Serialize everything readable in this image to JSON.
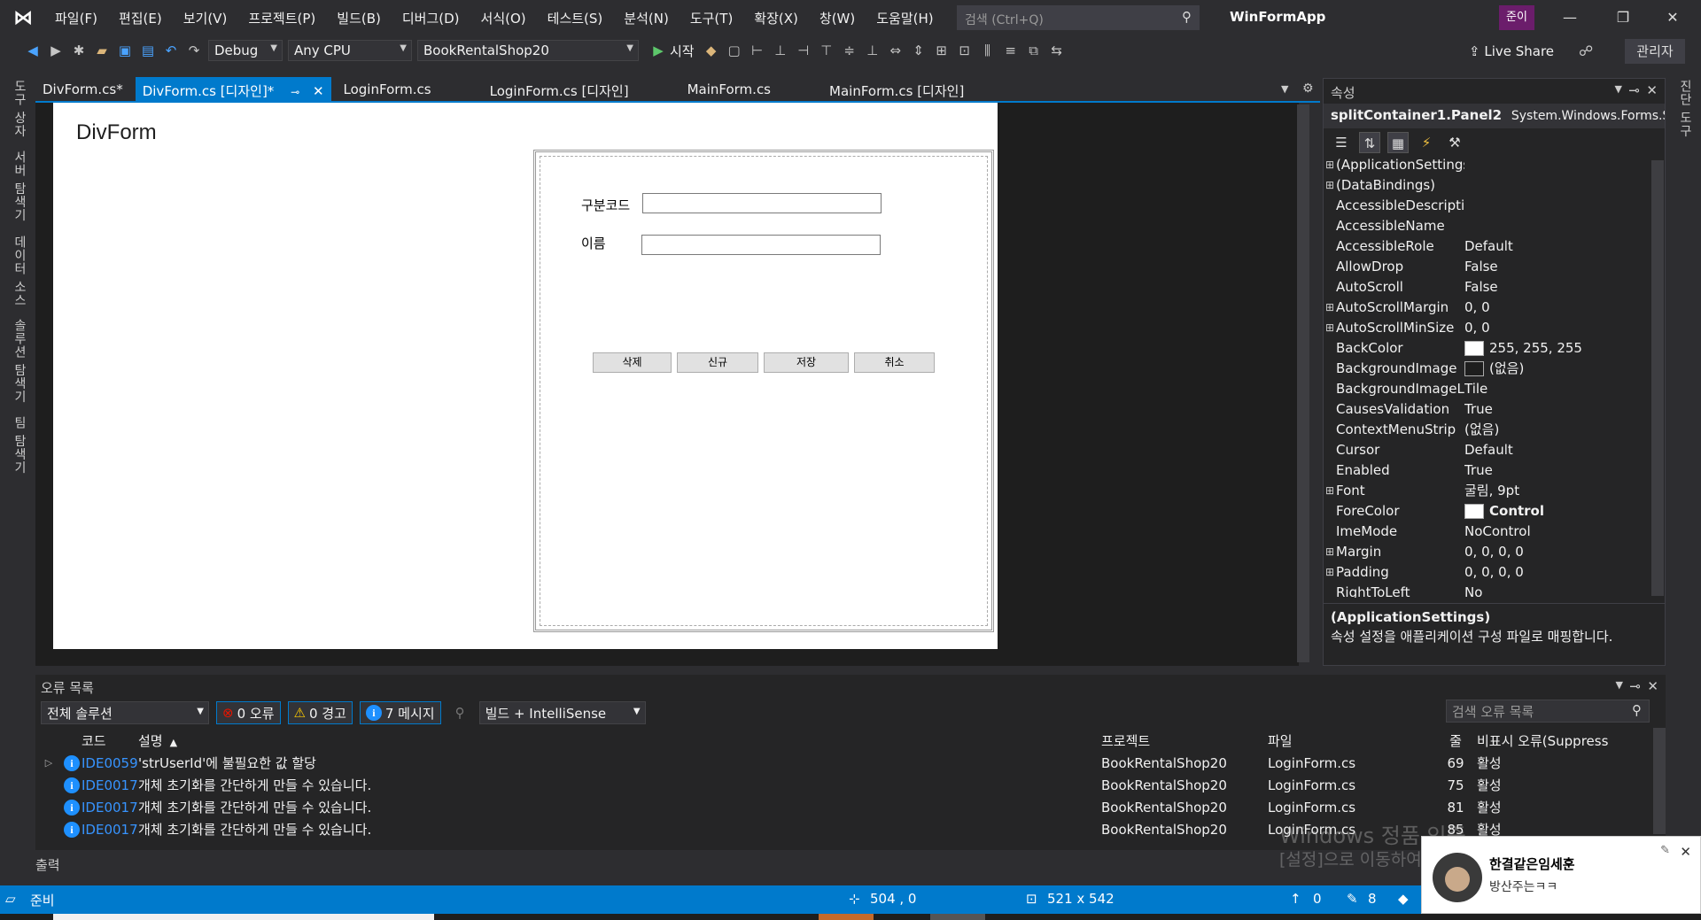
{
  "menubar": {
    "items": [
      "파일(F)",
      "편집(E)",
      "보기(V)",
      "프로젝트(P)",
      "빌드(B)",
      "디버그(D)",
      "서식(O)",
      "테스트(S)",
      "분석(N)",
      "도구(T)",
      "확장(X)",
      "창(W)",
      "도움말(H)"
    ],
    "search_placeholder": "검색 (Ctrl+Q)",
    "app_title": "WinFormApp",
    "user_badge": "준이"
  },
  "toolbar": {
    "config": "Debug",
    "platform": "Any CPU",
    "startup_project": "BookRentalShop20",
    "start_label": "시작",
    "live_share": "Live Share",
    "admin_label": "관리자"
  },
  "left_tabs": [
    "도구 상자",
    "서버 탐색기",
    "데이터 소스",
    "솔루션 탐색기",
    "팀 탐색기"
  ],
  "right_tabs": [
    "진단 도구"
  ],
  "doc_tabs": [
    "DivForm.cs*",
    "DivForm.cs [디자인]*",
    "LoginForm.cs",
    "LoginForm.cs [디자인]",
    "MainForm.cs",
    "MainForm.cs [디자인]"
  ],
  "designer": {
    "form_title": "DivForm",
    "label_code": "구분코드",
    "label_name": "이름",
    "btn_delete": "삭제",
    "btn_new": "신규",
    "btn_save": "저장",
    "btn_cancel": "취소"
  },
  "properties": {
    "title": "속성",
    "object_name": "splitContainer1.Panel2",
    "object_type": "System.Windows.Forms.Split",
    "rows": [
      {
        "name": "(ApplicationSettings)",
        "value": "",
        "expandable": true
      },
      {
        "name": "(DataBindings)",
        "value": "",
        "expandable": true
      },
      {
        "name": "AccessibleDescription",
        "value": "",
        "expandable": false
      },
      {
        "name": "AccessibleName",
        "value": "",
        "expandable": false
      },
      {
        "name": "AccessibleRole",
        "value": "Default",
        "expandable": false
      },
      {
        "name": "AllowDrop",
        "value": "False",
        "expandable": false
      },
      {
        "name": "AutoScroll",
        "value": "False",
        "expandable": false
      },
      {
        "name": "AutoScrollMargin",
        "value": "0, 0",
        "expandable": true
      },
      {
        "name": "AutoScrollMinSize",
        "value": "0, 0",
        "expandable": true
      },
      {
        "name": "BackColor",
        "value": "255, 255, 255",
        "expandable": false,
        "swatch": "#ffffff"
      },
      {
        "name": "BackgroundImage",
        "value": "(없음)",
        "expandable": false,
        "swatch": "#1e1e1e"
      },
      {
        "name": "BackgroundImageLay",
        "value": "Tile",
        "expandable": false
      },
      {
        "name": "CausesValidation",
        "value": "True",
        "expandable": false
      },
      {
        "name": "ContextMenuStrip",
        "value": "(없음)",
        "expandable": false
      },
      {
        "name": "Cursor",
        "value": "Default",
        "expandable": false
      },
      {
        "name": "Enabled",
        "value": "True",
        "expandable": false
      },
      {
        "name": "Font",
        "value": "굴림, 9pt",
        "expandable": true
      },
      {
        "name": "ForeColor",
        "value": "Control",
        "expandable": false,
        "swatch": "#ffffff",
        "bold": true
      },
      {
        "name": "ImeMode",
        "value": "NoControl",
        "expandable": false
      },
      {
        "name": "Margin",
        "value": "0, 0, 0, 0",
        "expandable": true
      },
      {
        "name": "Padding",
        "value": "0, 0, 0, 0",
        "expandable": true
      },
      {
        "name": "RightToLeft",
        "value": "No",
        "expandable": false
      }
    ],
    "desc_title": "(ApplicationSettings)",
    "desc_text": "속성 설정을 애플리케이션 구성 파일로 매핑합니다."
  },
  "error_list": {
    "title": "오류 목록",
    "scope": "전체 솔루션",
    "errors_label": "0 오류",
    "warnings_label": "0 경고",
    "messages_label": "7 메시지",
    "build_filter": "빌드 + IntelliSense",
    "search_placeholder": "검색 오류 목록",
    "columns": {
      "code": "코드",
      "desc": "설명",
      "project": "프로젝트",
      "file": "파일",
      "line": "줄",
      "suppress": "비표시 오류(Suppress"
    },
    "rows": [
      {
        "code": "IDE0059",
        "desc": "'strUserId'에 불필요한 값 할당",
        "project": "BookRentalShop20",
        "file": "LoginForm.cs",
        "line": "69",
        "state": "활성"
      },
      {
        "code": "IDE0017",
        "desc": "개체 초기화를 간단하게 만들 수 있습니다.",
        "project": "BookRentalShop20",
        "file": "LoginForm.cs",
        "line": "75",
        "state": "활성"
      },
      {
        "code": "IDE0017",
        "desc": "개체 초기화를 간단하게 만들 수 있습니다.",
        "project": "BookRentalShop20",
        "file": "LoginForm.cs",
        "line": "81",
        "state": "활성"
      },
      {
        "code": "IDE0017",
        "desc": "개체 초기화를 간단하게 만들 수 있습니다.",
        "project": "BookRentalShop20",
        "file": "LoginForm.cs",
        "line": "85",
        "state": "활성"
      }
    ]
  },
  "output_tab": "출력",
  "statusbar": {
    "status": "준비",
    "position": "504 , 0",
    "size": "521 x 542",
    "up_count": "0",
    "pencil_count": "8"
  },
  "watermark": {
    "line1": "Windows 정품 인증",
    "line2": "[설정]으로 이동하여 Windows를 정품 인증합니다."
  },
  "toast": {
    "name": "한결같은임세훈",
    "message": "방산주는ㅋㅋ"
  }
}
